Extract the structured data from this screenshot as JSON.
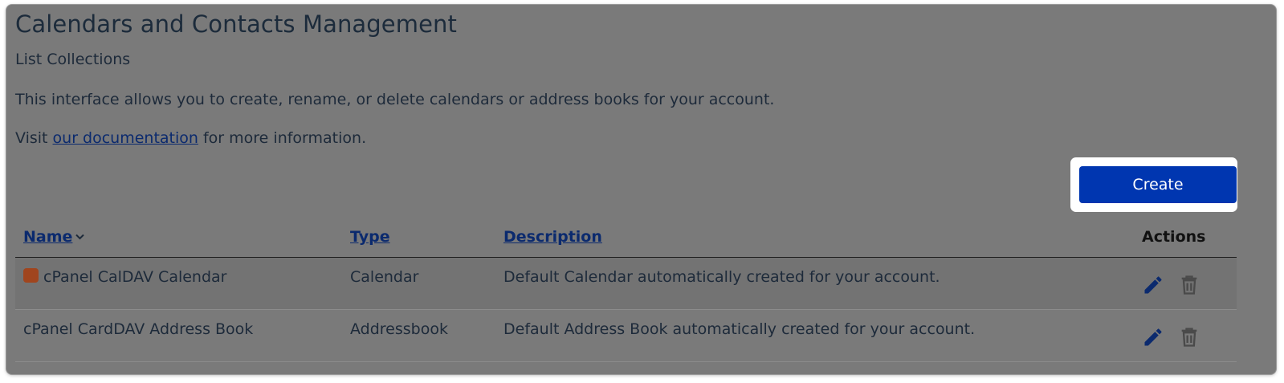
{
  "header": {
    "title": "Calendars and Contacts Management",
    "subtitle": "List Collections",
    "intro": "This interface allows you to create, rename, or delete calendars or address books for your account.",
    "doc_prefix": "Visit ",
    "doc_link": "our documentation",
    "doc_suffix": " for more information."
  },
  "toolbar": {
    "create_label": "Create"
  },
  "table": {
    "columns": {
      "name": "Name",
      "type": "Type",
      "description": "Description",
      "actions": "Actions"
    },
    "sort": {
      "column": "name",
      "icon": "chevron-down-icon"
    },
    "rows": [
      {
        "name": "cPanel CalDAV Calendar",
        "color": "#a0451e",
        "type": "Calendar",
        "description": "Default Calendar automatically created for your account."
      },
      {
        "name": "cPanel CardDAV Address Book",
        "type": "Addressbook",
        "description": "Default Address Book automatically created for your account."
      }
    ]
  },
  "colors": {
    "overlay": "#7a7a7a",
    "primary_button": "#0036b0",
    "link": "#0b2a6e",
    "edit_icon": "#0b2a6e",
    "delete_icon": "#4a4a4a"
  }
}
